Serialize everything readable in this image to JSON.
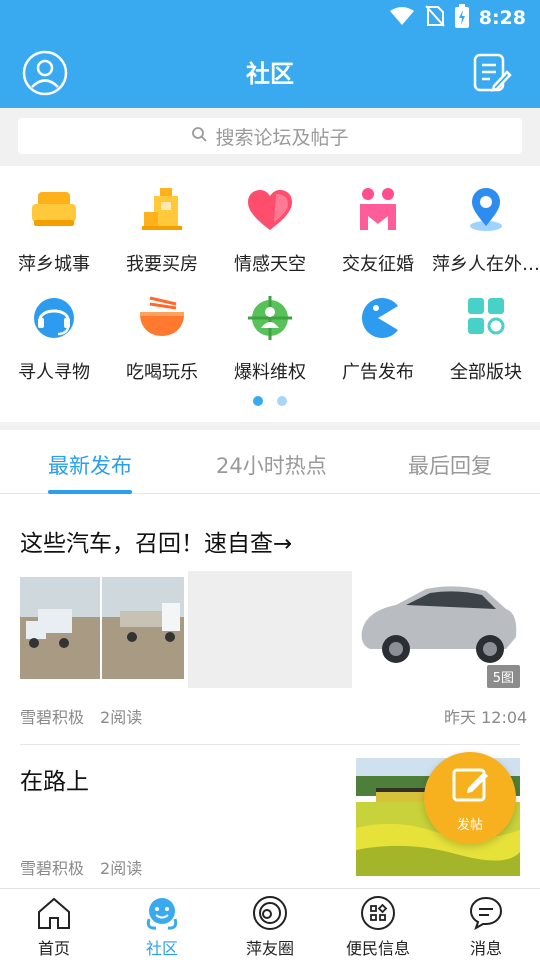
{
  "status_bar": {
    "time": "8:28"
  },
  "header": {
    "title": "社区"
  },
  "search": {
    "placeholder": "搜索论坛及帖子"
  },
  "categories": [
    {
      "label": "萍乡城事",
      "icon": "sofa-icon"
    },
    {
      "label": "我要买房",
      "icon": "building-icon"
    },
    {
      "label": "情感天空",
      "icon": "heart-icon"
    },
    {
      "label": "交友征婚",
      "icon": "couple-icon"
    },
    {
      "label": "萍乡人在外…",
      "icon": "location-pin-icon"
    },
    {
      "label": "寻人寻物",
      "icon": "headset-icon"
    },
    {
      "label": "吃喝玩乐",
      "icon": "noodle-bowl-icon"
    },
    {
      "label": "爆料维权",
      "icon": "person-target-icon"
    },
    {
      "label": "广告发布",
      "icon": "pacman-icon"
    },
    {
      "label": "全部版块",
      "icon": "grid-blocks-icon"
    }
  ],
  "pager": {
    "pages": 2,
    "current": 1
  },
  "tabs": [
    {
      "label": "最新发布",
      "active": true
    },
    {
      "label": "24小时热点",
      "active": false
    },
    {
      "label": "最后回复",
      "active": false
    }
  ],
  "posts": [
    {
      "title": "这些汽车，召回！速自查→",
      "author": "雪碧积极",
      "reads": "2阅读",
      "time": "昨天 12:04",
      "image_count": "5图"
    },
    {
      "title": "在路上",
      "author": "雪碧积极",
      "reads": "2阅读"
    }
  ],
  "fab": {
    "label": "发帖"
  },
  "bottom_nav": [
    {
      "label": "首页",
      "icon": "home-icon",
      "active": false
    },
    {
      "label": "社区",
      "icon": "community-icon",
      "active": true
    },
    {
      "label": "萍友圈",
      "icon": "friends-circle-icon",
      "active": false
    },
    {
      "label": "便民信息",
      "icon": "services-icon",
      "active": false
    },
    {
      "label": "消息",
      "icon": "message-icon",
      "active": false
    }
  ],
  "colors": {
    "brand": "#3aaaf0",
    "accent_tab": "#2aa0ec",
    "fab": "#f7b11e"
  }
}
